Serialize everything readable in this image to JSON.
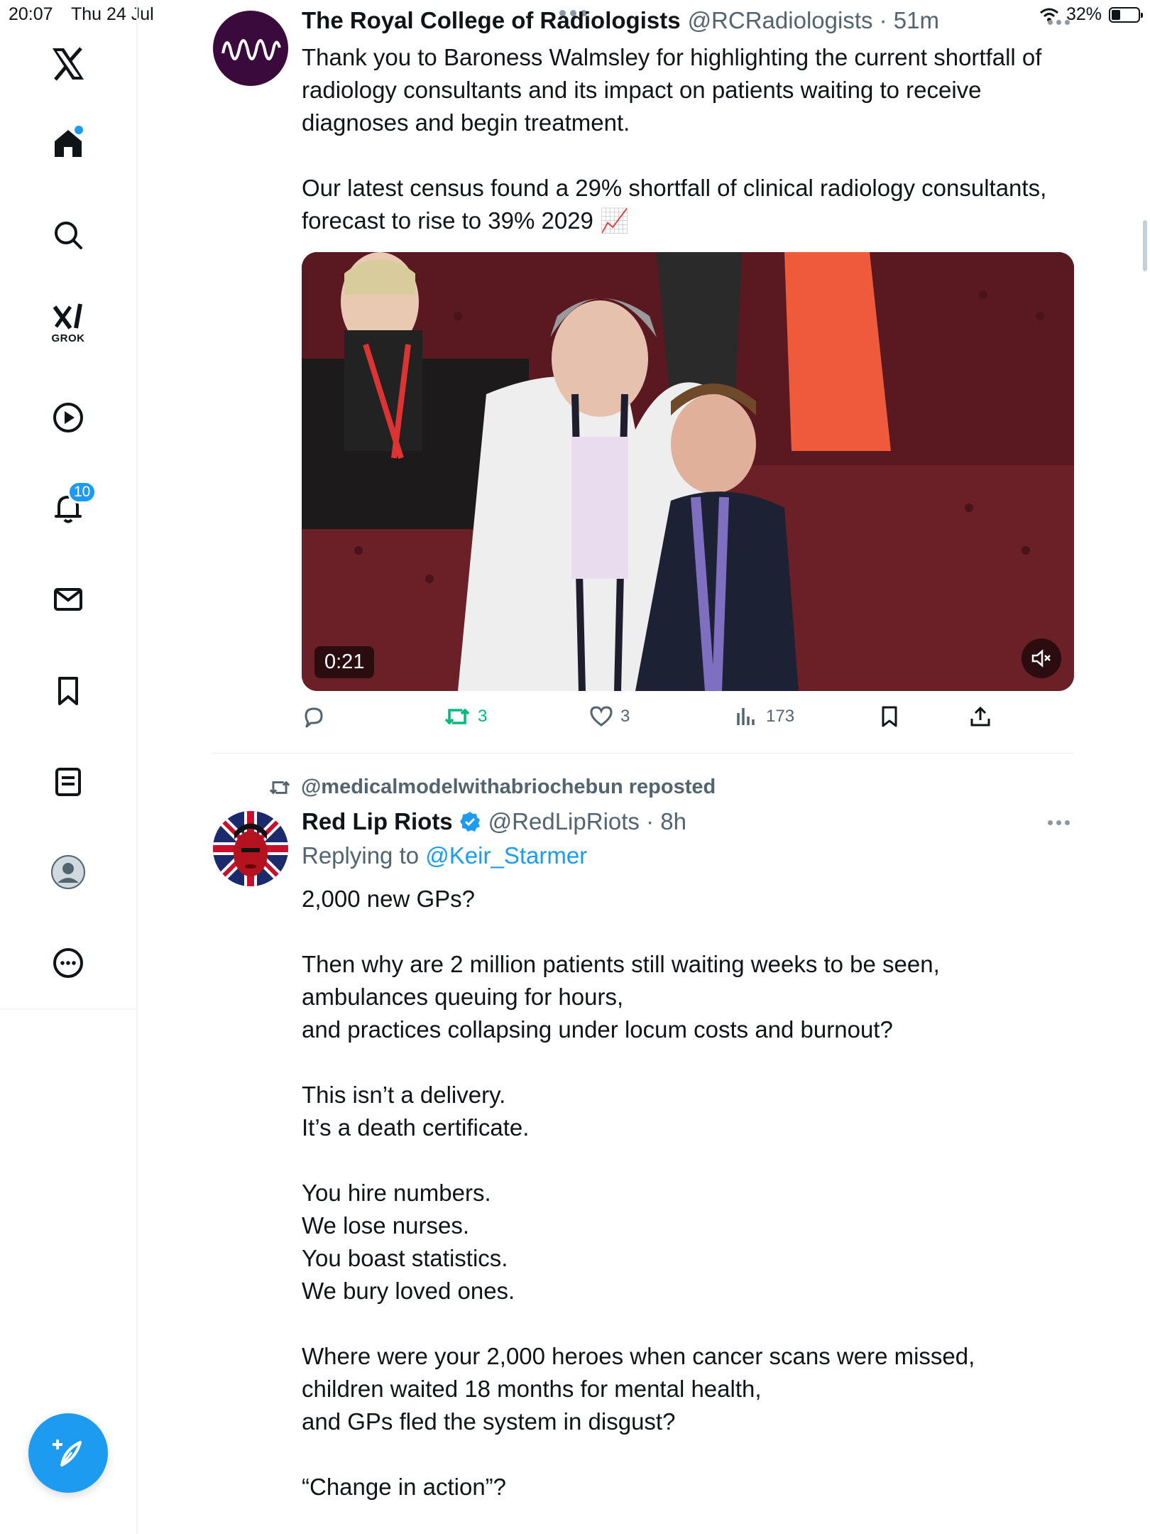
{
  "status_bar": {
    "time": "20:07",
    "date": "Thu 24 Jul",
    "battery": "32%"
  },
  "sidebar": {
    "items": [
      {
        "name": "x-logo",
        "icon": "x-logo-icon"
      },
      {
        "name": "home",
        "icon": "home-icon"
      },
      {
        "name": "explore",
        "icon": "search-icon"
      },
      {
        "name": "grok",
        "icon": "grok-icon",
        "label": "GROK"
      },
      {
        "name": "videos",
        "icon": "play-circle-icon"
      },
      {
        "name": "notifications",
        "icon": "bell-icon",
        "badge": "10"
      },
      {
        "name": "messages",
        "icon": "envelope-icon"
      },
      {
        "name": "bookmarks",
        "icon": "bookmark-icon"
      },
      {
        "name": "lists",
        "icon": "list-icon"
      },
      {
        "name": "profile",
        "icon": "avatar-icon"
      },
      {
        "name": "more",
        "icon": "ellipsis-icon"
      }
    ],
    "compose_icon": "compose-icon"
  },
  "tweets": [
    {
      "name": "The Royal College of Radiologists",
      "handle": "@RCRadiologists · 51m",
      "text": "Thank you to Baroness Walmsley for highlighting the current shortfall of radiology consultants and its impact on patients waiting to receive diagnoses and begin treatment.\n\nOur latest census found a 29% shortfall of clinical radiology consultants, forecast to rise to 39% 2029 📈",
      "video_duration": "0:21",
      "stats": {
        "replies": "",
        "reposts": "3",
        "likes": "3",
        "views": "173"
      }
    },
    {
      "reposted_by": "@medicalmodelwithabriochebun reposted",
      "name": "Red Lip Riots",
      "handle": "@RedLipRiots · 8h",
      "replying_prefix": "Replying to",
      "replying_to": "@Keir_Starmer",
      "text": "2,000 new GPs?\n\nThen why are 2 million patients still waiting weeks to be seen,\nambulances queuing for hours,\nand practices collapsing under locum costs and burnout?\n\nThis isn’t a delivery.\nIt’s a death certificate.\n\nYou hire numbers.\nWe lose nurses.\nYou boast statistics.\nWe bury loved ones.\n\nWhere were your 2,000 heroes when cancer scans were missed,\nchildren waited 18 months for mental health,\nand GPs fled the system in disgust?\n\n“Change in action”?"
    }
  ],
  "colors": {
    "accent": "#1d9bf0",
    "repost": "#00ba7c",
    "muted": "#536471",
    "text": "#0f1419"
  }
}
